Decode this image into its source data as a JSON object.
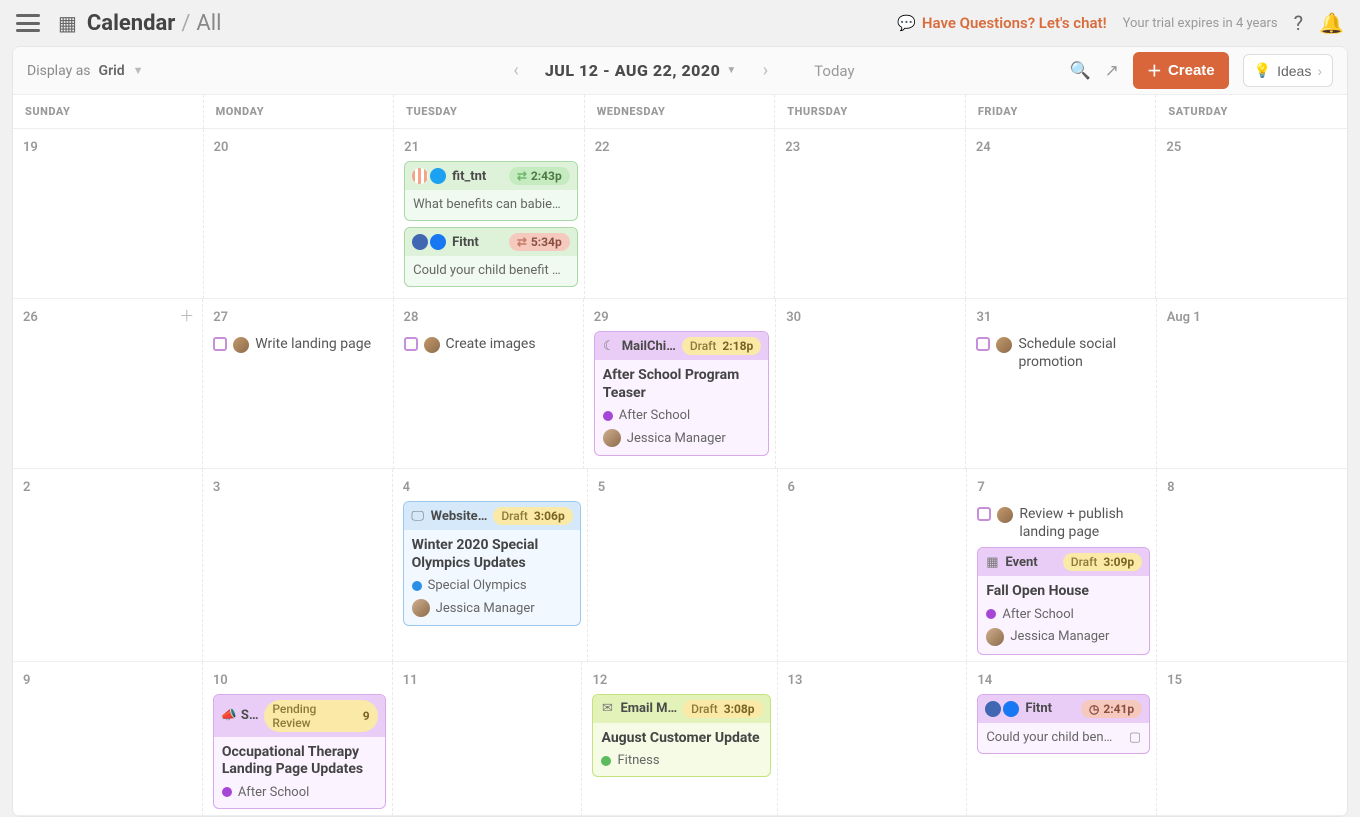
{
  "header": {
    "title": "Calendar",
    "subtitle": "All",
    "questions": "Have Questions? Let's chat!",
    "trial": "Your trial expires in 4 years"
  },
  "toolbar": {
    "display_as_label": "Display as",
    "display_as_value": "Grid",
    "date_range": "JUL 12 - AUG 22, 2020",
    "today": "Today",
    "create": "Create",
    "ideas": "Ideas"
  },
  "dayheaders": [
    "SUNDAY",
    "MONDAY",
    "TUESDAY",
    "WEDNESDAY",
    "THURSDAY",
    "FRIDAY",
    "SATURDAY"
  ],
  "dates": {
    "w1": [
      "19",
      "20",
      "21",
      "22",
      "23",
      "24",
      "25"
    ],
    "w2": [
      "26",
      "27",
      "28",
      "29",
      "30",
      "31",
      "Aug 1"
    ],
    "w3": [
      "2",
      "3",
      "4",
      "5",
      "6",
      "7",
      "8"
    ],
    "w4": [
      "9",
      "10",
      "11",
      "12",
      "13",
      "14",
      "15"
    ]
  },
  "tasks": {
    "t_landing": "Write landing page",
    "t_images": "Create images",
    "t_schedule": "Schedule social promotion",
    "t_review": "Review + publish landing page"
  },
  "cards": {
    "fit_tnt": {
      "src": "fit_tnt",
      "time": "2:43p",
      "body": "What benefits can babie…"
    },
    "fitnt_a": {
      "src": "Fitnt",
      "time": "5:34p",
      "body": "Could your child benefit …"
    },
    "mailchimp": {
      "label": "MailChi…",
      "status": "Draft",
      "time": "2:18p",
      "title": "After School Program Teaser",
      "tag": "After School",
      "owner": "Jessica Manager"
    },
    "website": {
      "label": "Website…",
      "status": "Draft",
      "time": "3:06p",
      "title": "Winter 2020 Special Olympics Updates",
      "tag": "Special Olympics",
      "owner": "Jessica Manager"
    },
    "event": {
      "label": "Event",
      "status": "Draft",
      "time": "3:09p",
      "title": "Fall Open House",
      "tag": "After School",
      "owner": "Jessica Manager"
    },
    "social": {
      "label": "S…",
      "status": "Pending Review",
      "count": "9",
      "title": "Occupational Therapy Landing Page Updates",
      "tag": "After School"
    },
    "email": {
      "label": "Email M…",
      "status": "Draft",
      "time": "3:08p",
      "title": "August Customer Update",
      "tag": "Fitness"
    },
    "fitnt_b": {
      "src": "Fitnt",
      "time": "2:41p",
      "body": "Could your child ben…"
    }
  }
}
